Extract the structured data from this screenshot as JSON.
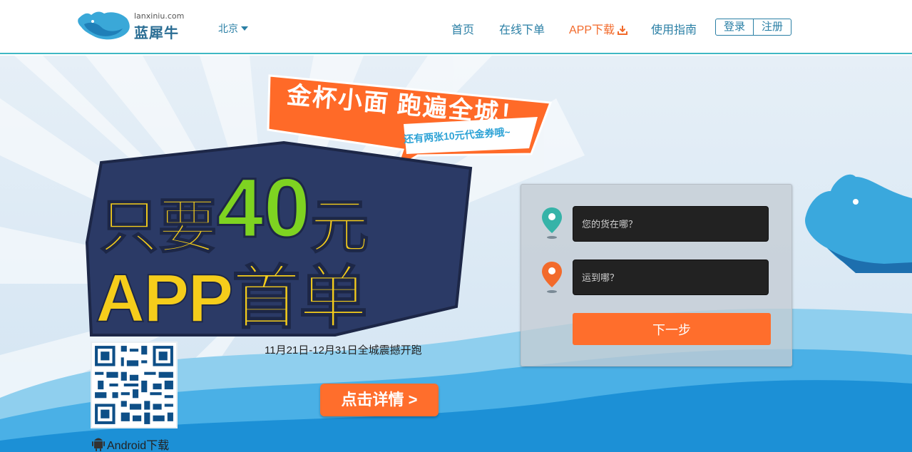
{
  "header": {
    "logo_en": "lanxiniu.com",
    "logo_cn": "蓝犀牛",
    "city": "北京",
    "nav": [
      "首页",
      "在线下单",
      "APP下载",
      "使用指南"
    ],
    "login": "登录",
    "register": "注册"
  },
  "banner": {
    "headline_bubble": "金杯小面 跑遍全城！",
    "headline_sub": "还有两张10元代金券哦~",
    "big_line1_a": "只要",
    "big_line1_b": "40",
    "big_line1_c": "元",
    "big_line2": "APP首单",
    "caption": "11月21日-12月31日全城震撼开跑",
    "detail_button": "点击详情 >",
    "android_label": "Android下载"
  },
  "form": {
    "origin_placeholder": "您的货在哪？",
    "dest_placeholder": "运到哪？",
    "next_button": "下一步"
  },
  "colors": {
    "brand_blue": "#2a7fa5",
    "accent_orange": "#ff6e2c",
    "pin_teal": "#36b3a8",
    "pin_orange": "#f26a2b",
    "poster_yellow": "#f5cd1b",
    "poster_green": "#7ed321",
    "poster_navy": "#2b3a66"
  },
  "icons": [
    "rhino-logo",
    "caret-down-icon",
    "download-icon",
    "location-pin-icon",
    "qr-code",
    "android-icon"
  ]
}
